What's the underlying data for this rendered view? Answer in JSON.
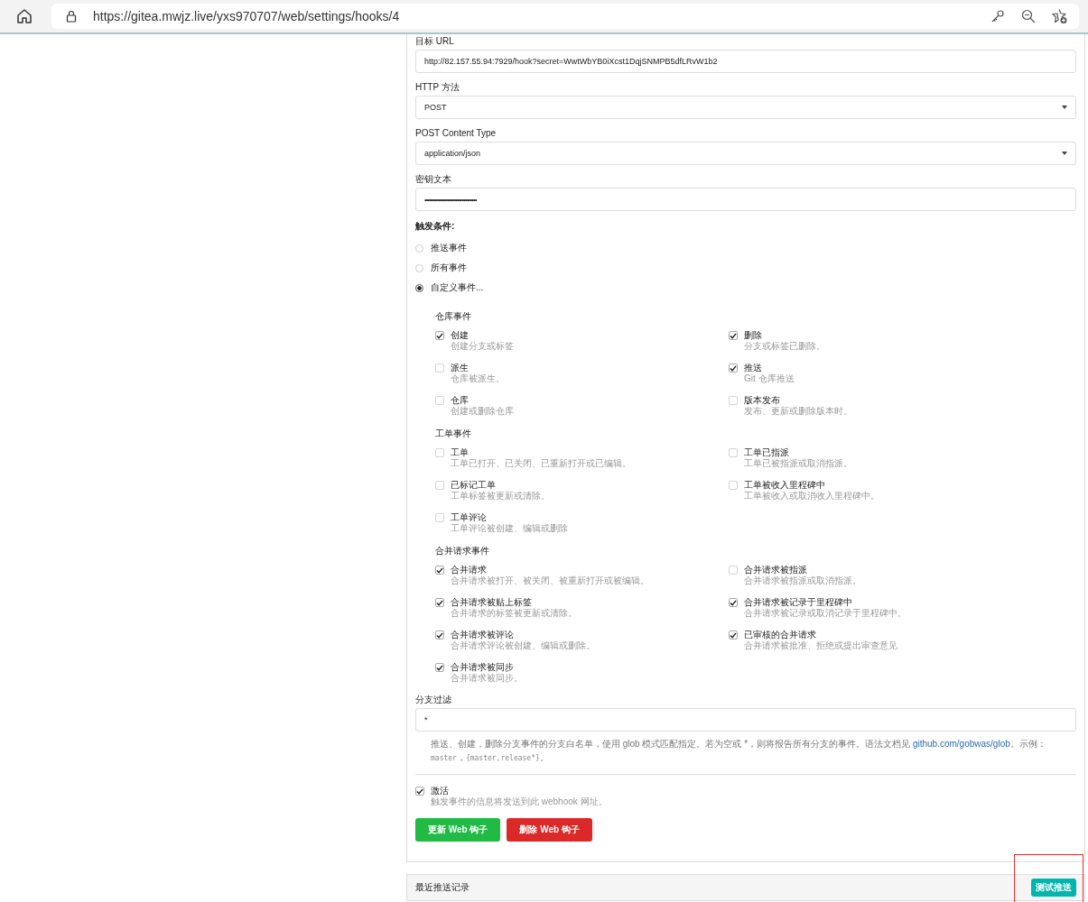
{
  "browser": {
    "url": "https://gitea.mwjz.live/yxs970707/web/settings/hooks/4"
  },
  "fields": [
    {
      "kind": "input",
      "label": "目标 URL",
      "value": "http://82.157.55.94:7929/hook?secret=WwtWbYB0iXcst1DqjSNMPB5dfLRvW1b2"
    },
    {
      "kind": "select",
      "label": "HTTP 方法",
      "value": "POST"
    },
    {
      "kind": "select",
      "label": "POST Content Type",
      "value": "application/json"
    },
    {
      "kind": "password",
      "label": "密钥文本",
      "value": "••••••••••••••••••••••••••••••••"
    }
  ],
  "trigger": {
    "label": "触发条件:",
    "options": [
      {
        "label": "推送事件",
        "selected": false
      },
      {
        "label": "所有事件",
        "selected": false
      },
      {
        "label": "自定义事件...",
        "selected": true
      }
    ]
  },
  "event_groups": [
    {
      "title": "仓库事件",
      "events": [
        {
          "name": "创建",
          "description": "创建分支或标签",
          "checked": true
        },
        {
          "name": "删除",
          "description": "分支或标签已删除。",
          "checked": true
        },
        {
          "name": "派生",
          "description": "仓库被派生。",
          "checked": false
        },
        {
          "name": "推送",
          "description": "Git 仓库推送",
          "checked": true
        },
        {
          "name": "仓库",
          "description": "创建或删除仓库",
          "checked": false
        },
        {
          "name": "版本发布",
          "description": "发布、更新或删除版本时。",
          "checked": false
        }
      ]
    },
    {
      "title": "工单事件",
      "events": [
        {
          "name": "工单",
          "description": "工单已打开、已关闭、已重新打开或已编辑。",
          "checked": false
        },
        {
          "name": "工单已指派",
          "description": "工单已被指派或取消指派。",
          "checked": false
        },
        {
          "name": "已标记工单",
          "description": "工单标签被更新或清除。",
          "checked": false
        },
        {
          "name": "工单被收入里程碑中",
          "description": "工单被收入或取消收入里程碑中。",
          "checked": false
        },
        {
          "name": "工单评论",
          "description": "工单评论被创建、编辑或删除",
          "checked": false
        }
      ]
    },
    {
      "title": "合并请求事件",
      "events": [
        {
          "name": "合并请求",
          "description": "合并请求被打开、被关闭、被重新打开或被编辑。",
          "checked": true
        },
        {
          "name": "合并请求被指派",
          "description": "合并请求被指派或取消指派。",
          "checked": false
        },
        {
          "name": "合并请求被贴上标签",
          "description": "合并请求的标签被更新或清除。",
          "checked": true
        },
        {
          "name": "合并请求被记录于里程碑中",
          "description": "合并请求被记录或取消记录于里程碑中。",
          "checked": true
        },
        {
          "name": "合并请求被评论",
          "description": "合并请求评论被创建、编辑或删除。",
          "checked": true
        },
        {
          "name": "已审核的合并请求",
          "description": "合并请求被批准、拒绝或提出审查意见",
          "checked": true
        },
        {
          "name": "合并请求被同步",
          "description": "合并请求被同步。",
          "checked": true
        }
      ]
    }
  ],
  "branch_filter": {
    "label": "分支过滤",
    "value": "*",
    "help": [
      {
        "kind": "text",
        "text": "推送、创建，删除分支事件的分支白名单，使用 glob 模式匹配指定。若为空或 *，则将报告所有分支的事件。语法文档见 "
      },
      {
        "kind": "link",
        "text": "github.com/gobwas/glob"
      },
      {
        "kind": "text",
        "text": "。示例："
      },
      {
        "kind": "code",
        "text": "master"
      },
      {
        "kind": "text",
        "text": "，"
      },
      {
        "kind": "code",
        "text": "{master,release*}"
      },
      {
        "kind": "text",
        "text": "。"
      }
    ]
  },
  "active": {
    "label": "激活",
    "description": "触发事件的信息将发送到此 webhook 网址。",
    "checked": true
  },
  "buttons": [
    {
      "label": "更新 Web 钩子",
      "kind": "primary"
    },
    {
      "label": "删除 Web 钩子",
      "kind": "danger"
    }
  ],
  "deliveries": {
    "title": "最近推送记录",
    "test_button": "测试推送"
  }
}
